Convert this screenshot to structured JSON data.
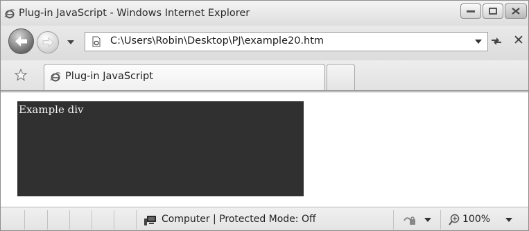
{
  "window": {
    "title": "Plug-in JavaScript - Windows Internet Explorer",
    "icon": "ie-icon",
    "controls": [
      "minimize-icon",
      "maximize-icon",
      "close-icon"
    ]
  },
  "navigation": {
    "back_icon": "back-arrow-icon",
    "forward_icon": "forward-arrow-icon",
    "address": "C:\\Users\\Robin\\Desktop\\PJ\\example20.htm",
    "refresh_icon": "refresh-icon",
    "stop_label": "✕"
  },
  "tabs": [
    {
      "label": "Plug-in JavaScript",
      "icon": "ie-page-icon",
      "active": true
    }
  ],
  "content": {
    "example_div_text": "Example div",
    "div_background": "#303030"
  },
  "status": {
    "zone_text": "Computer | Protected Mode: Off",
    "zoom": "100%"
  }
}
